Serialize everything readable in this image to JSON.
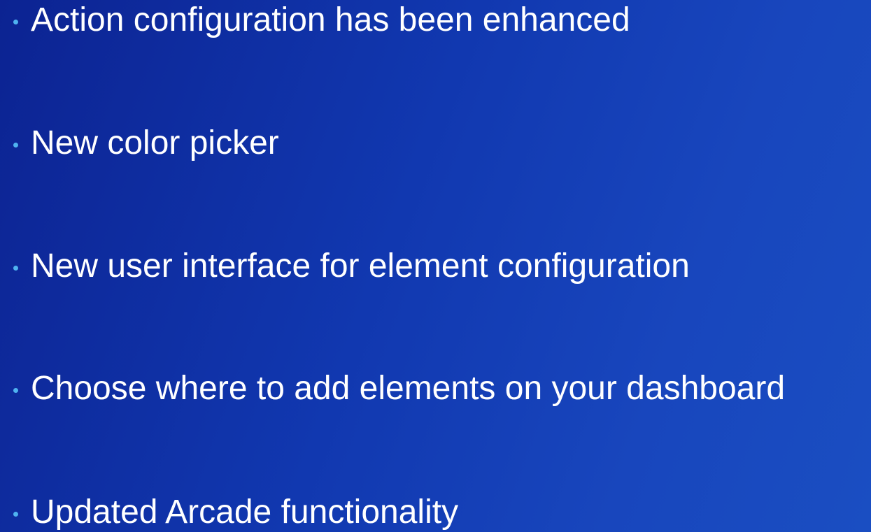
{
  "slide": {
    "bullets": [
      {
        "text": "Action configuration has been enhanced"
      },
      {
        "text": "New color picker"
      },
      {
        "text": "New user interface for element configuration"
      },
      {
        "text": "Choose where to add elements on your dashboard"
      },
      {
        "text": "Updated Arcade functionality"
      }
    ]
  },
  "colors": {
    "background": "#1138b0",
    "text": "#ffffff",
    "bullet": "#4fb3f0"
  }
}
